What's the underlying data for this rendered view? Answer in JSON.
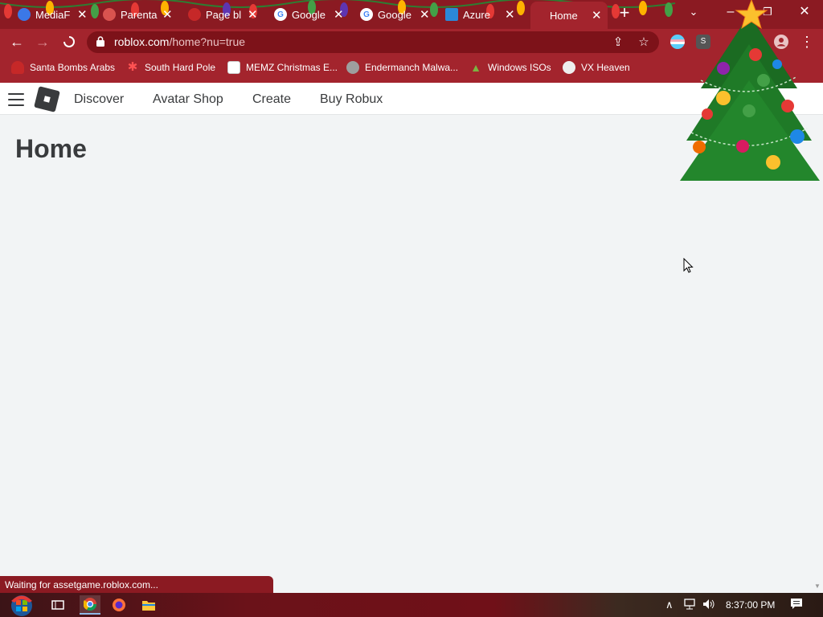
{
  "browser": {
    "tabs": [
      {
        "title": "MediaF",
        "favicon_color": "#3b78e7"
      },
      {
        "title": "Parenta",
        "favicon_color": "#d9534f"
      },
      {
        "title": "Page bl",
        "favicon_color": "#c62828"
      },
      {
        "title": "Google",
        "favicon_color": "#4285f4"
      },
      {
        "title": "Google",
        "favicon_color": "#4285f4"
      },
      {
        "title": "Azure",
        "favicon_color": "#2b88d8"
      },
      {
        "title": "Home",
        "favicon_color": "#a3242d"
      }
    ],
    "address": {
      "host": "roblox.com",
      "path": "/home?nu=true"
    },
    "status_text": "Waiting for assetgame.roblox.com...",
    "extension_badge": "S",
    "window_controls": {
      "minimize": "–",
      "restore": "❐",
      "close": "✕"
    }
  },
  "bookmarks": [
    {
      "label": "Santa Bombs Arabs",
      "icon": "santa-icon"
    },
    {
      "label": "South Hard Pole",
      "icon": "snowflake-icon"
    },
    {
      "label": "MEMZ Christmas E...",
      "icon": "file-icon"
    },
    {
      "label": "Endermanch Malwa...",
      "icon": "raccoon-icon"
    },
    {
      "label": "Windows ISOs",
      "icon": "tree-icon"
    },
    {
      "label": "VX Heaven",
      "icon": "vx-icon"
    }
  ],
  "roblox_nav": {
    "links": [
      "Discover",
      "Avatar Shop",
      "Create",
      "Buy Robux"
    ]
  },
  "page": {
    "title": "Home"
  },
  "taskbar": {
    "time": "8:37:00 PM"
  },
  "colors": {
    "chrome_frame": "#a3242d",
    "tabstrip": "#8b1a22",
    "omnibox": "#7d1219",
    "page_bg": "#f2f4f5",
    "nav_text": "#393b3d"
  }
}
